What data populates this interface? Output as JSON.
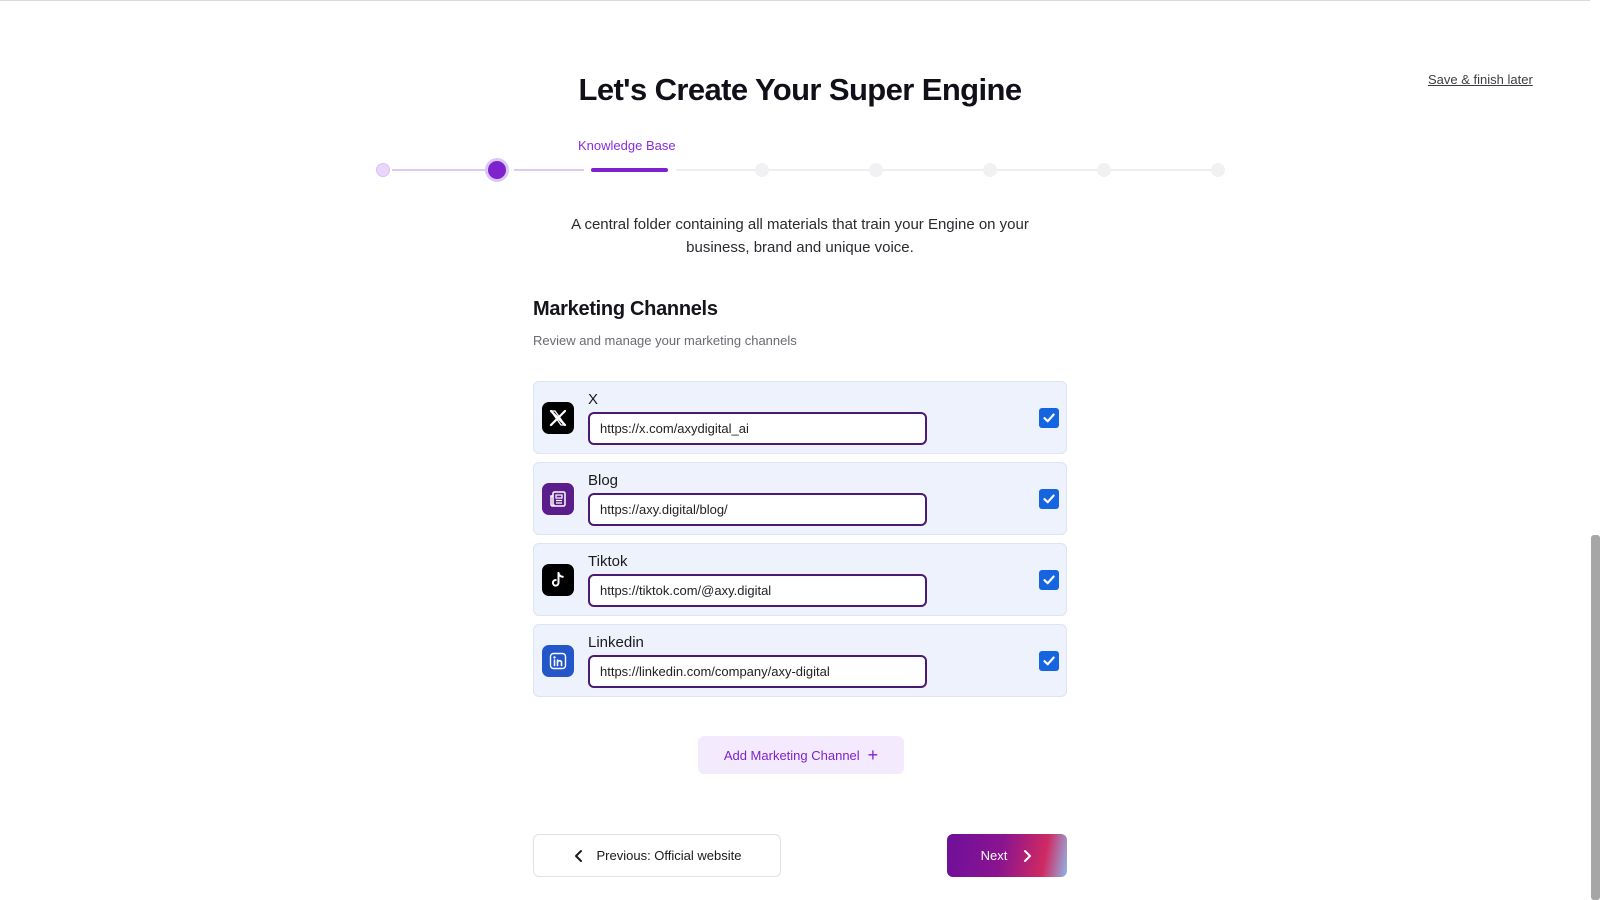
{
  "header": {
    "title": "Let's Create Your Super Engine",
    "save_later": "Save & finish later"
  },
  "stepper": {
    "current_step_label": "Knowledge Base",
    "total_steps": 8,
    "current_step_index": 2
  },
  "description": "A central folder containing all materials that train your Engine on your business, brand and unique voice.",
  "section": {
    "title": "Marketing Channels",
    "subtitle": "Review and manage your marketing channels"
  },
  "channels": [
    {
      "name": "X",
      "url": "https://x.com/axydigital_ai",
      "checked": true,
      "icon": "x-logo-icon",
      "icon_bg": "#000000"
    },
    {
      "name": "Blog",
      "url": "https://axy.digital/blog/",
      "checked": true,
      "icon": "newspaper-icon",
      "icon_bg": "#5b1d8c"
    },
    {
      "name": "Tiktok",
      "url": "https://tiktok.com/@axy.digital",
      "checked": true,
      "icon": "tiktok-icon",
      "icon_bg": "#000000"
    },
    {
      "name": "Linkedin",
      "url": "https://linkedin.com/company/axy-digital",
      "checked": true,
      "icon": "linkedin-icon",
      "icon_bg": "#2256c9"
    }
  ],
  "actions": {
    "add_channel": "Add Marketing Channel",
    "previous": "Previous: Official website",
    "next": "Next"
  },
  "colors": {
    "accent": "#7e22ce",
    "checkbox": "#1565e0",
    "channel_bg": "#edf2fc"
  }
}
